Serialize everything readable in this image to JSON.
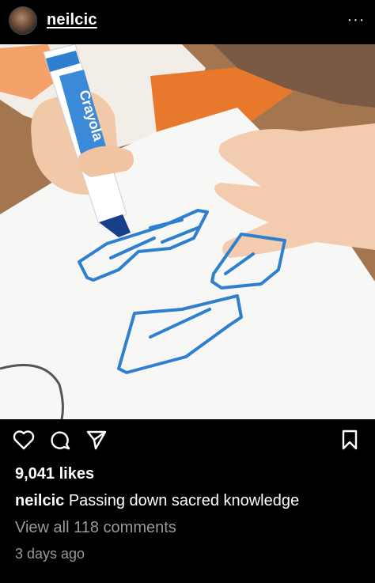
{
  "post": {
    "username": "neilcic",
    "more_label": "···",
    "likes": "9,041 likes",
    "caption_user": "neilcic",
    "caption_text": "Passing down sacred knowledge",
    "comments_link": "View all 118 comments",
    "timestamp": "3 days ago",
    "marker_brand": "Crayola"
  },
  "icons": {
    "like": "heart-icon",
    "comment": "comment-icon",
    "share": "send-icon",
    "save": "bookmark-icon",
    "more": "more-icon"
  },
  "colors": {
    "background": "#000000",
    "text": "#ffffff",
    "muted_text": "#9a9a9a",
    "marker_blue": "#2f7fd0"
  }
}
